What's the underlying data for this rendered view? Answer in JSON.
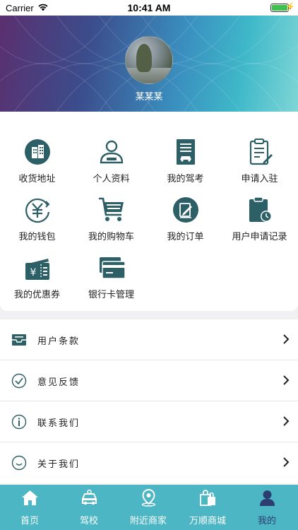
{
  "status_bar": {
    "carrier": "Carrier",
    "time": "10:41 AM"
  },
  "profile": {
    "username": "某某某"
  },
  "grid": [
    {
      "label": "收货地址",
      "icon": "building-icon"
    },
    {
      "label": "个人资料",
      "icon": "person-icon"
    },
    {
      "label": "我的驾考",
      "icon": "driving-test-icon"
    },
    {
      "label": "申请入驻",
      "icon": "clipboard-edit-icon"
    },
    {
      "label": "我的钱包",
      "icon": "yuan-wallet-icon"
    },
    {
      "label": "我的购物车",
      "icon": "cart-icon"
    },
    {
      "label": "我的订单",
      "icon": "order-edit-icon"
    },
    {
      "label": "用户申请记录",
      "icon": "application-record-icon"
    },
    {
      "label": "我的优惠券",
      "icon": "coupon-icon"
    },
    {
      "label": "银行卡管理",
      "icon": "bank-card-icon"
    }
  ],
  "list": [
    {
      "label": "用户条款",
      "icon": "mail-icon"
    },
    {
      "label": "意见反馈",
      "icon": "check-circle-icon"
    },
    {
      "label": "联系我们",
      "icon": "info-icon"
    },
    {
      "label": "关于我们",
      "icon": "smile-icon"
    }
  ],
  "tabs": [
    {
      "label": "首页",
      "icon": "home-icon"
    },
    {
      "label": "驾校",
      "icon": "car-icon"
    },
    {
      "label": "附近商家",
      "icon": "location-icon"
    },
    {
      "label": "万顺商城",
      "icon": "shopping-bag-icon"
    },
    {
      "label": "我的",
      "icon": "user-icon",
      "active": true
    }
  ],
  "colors": {
    "accent": "#4db6c4",
    "icon_dark": "#2c5f66",
    "active_tab": "#2c3e70"
  }
}
